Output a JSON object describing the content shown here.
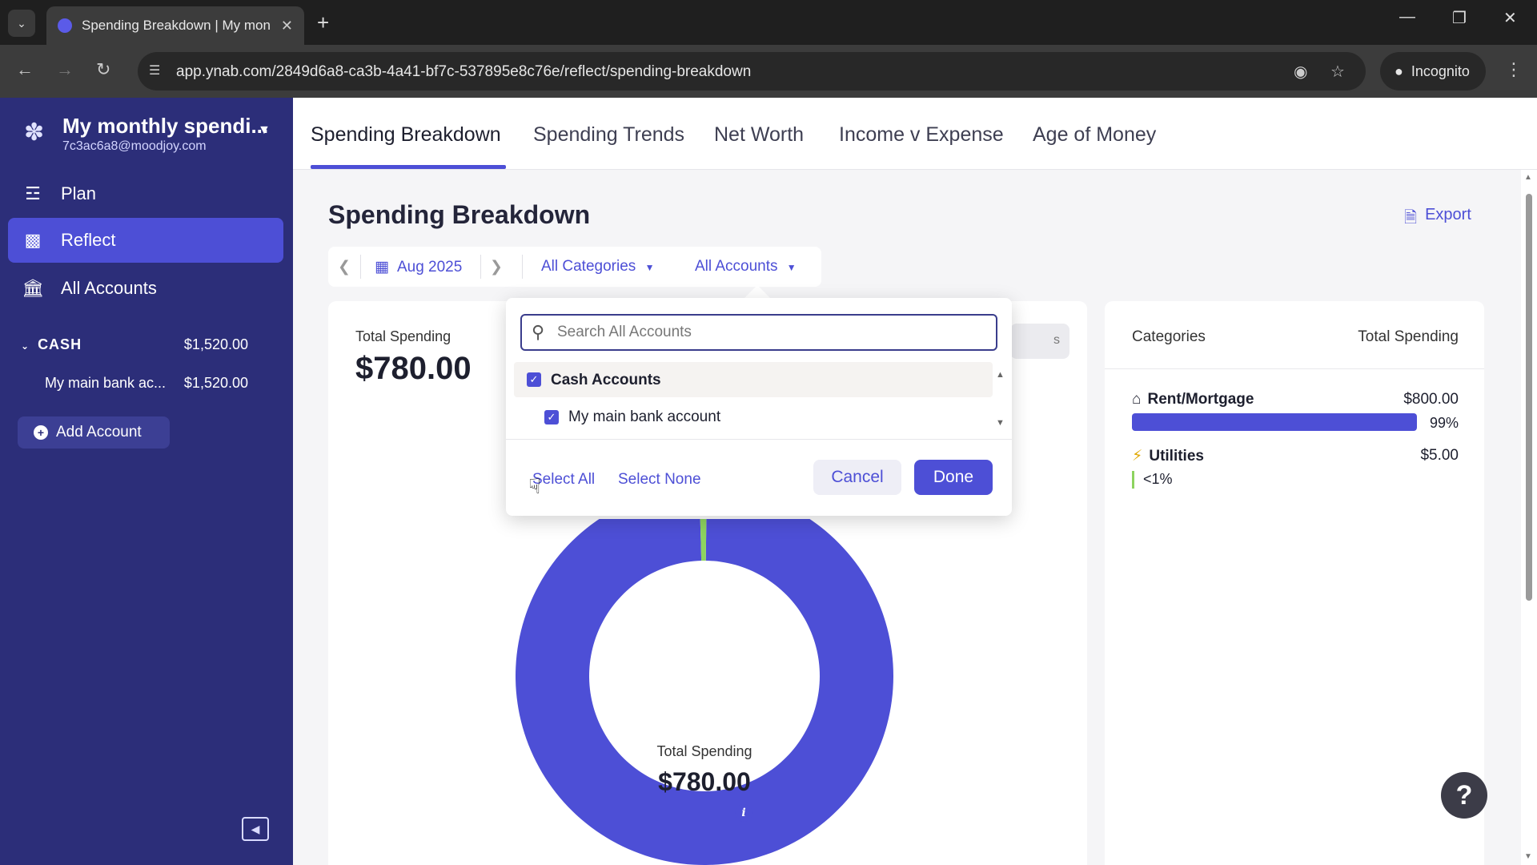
{
  "browser": {
    "tab_title": "Spending Breakdown | My mon",
    "url": "app.ynab.com/2849d6a8-ca3b-4a41-bf7c-537895e8c76e/reflect/spending-breakdown",
    "profile_label": "Incognito"
  },
  "sidebar": {
    "budget_name": "My monthly spendi...",
    "budget_email": "7c3ac6a8@moodjoy.com",
    "nav": [
      {
        "label": "Plan",
        "icon": "plan-icon"
      },
      {
        "label": "Reflect",
        "icon": "bar-chart-icon",
        "active": true
      },
      {
        "label": "All Accounts",
        "icon": "bank-icon"
      }
    ],
    "group": {
      "label": "CASH",
      "amount": "$1,520.00"
    },
    "accounts": [
      {
        "name": "My main bank ac...",
        "amount": "$1,520.00"
      }
    ],
    "add_account_label": "Add Account"
  },
  "report_tabs": [
    {
      "label": "Spending Breakdown",
      "active": true
    },
    {
      "label": "Spending Trends"
    },
    {
      "label": "Net Worth"
    },
    {
      "label": "Income v Expense"
    },
    {
      "label": "Age of Money"
    }
  ],
  "page": {
    "title": "Spending Breakdown",
    "export_label": "Export",
    "period": "Aug 2025",
    "category_filter": "All Categories",
    "account_filter": "All Accounts"
  },
  "summary": {
    "total_label": "Total Spending",
    "total_value": "$780.00",
    "ghost_button_text": "s"
  },
  "chart_data": {
    "type": "pie",
    "categories": [
      "Rent/Mortgage",
      "Utilities"
    ],
    "values": [
      800.0,
      5.0
    ],
    "center_label": "Total Spending",
    "center_value": "$780.00",
    "colors": [
      "#4d4fd6",
      "#8dd35f"
    ]
  },
  "categories_panel": {
    "header_left": "Categories",
    "header_right": "Total Spending",
    "rows": [
      {
        "name": "Rent/Mortgage",
        "amount": "$800.00",
        "percent": "99%",
        "fraction": 0.99,
        "icon": "house-icon"
      },
      {
        "name": "Utilities",
        "amount": "$5.00",
        "percent": "<1%",
        "fraction": 0.01,
        "icon": "lightning-icon"
      }
    ]
  },
  "dropdown": {
    "search_placeholder": "Search All Accounts",
    "group_label": "Cash Accounts",
    "account_label": "My main bank account",
    "select_all": "Select All",
    "select_none": "Select None",
    "cancel": "Cancel",
    "done": "Done"
  },
  "colors": {
    "sidebar": "#2c2e79",
    "accent": "#4d4fd6",
    "utilities": "#8dd35f"
  }
}
